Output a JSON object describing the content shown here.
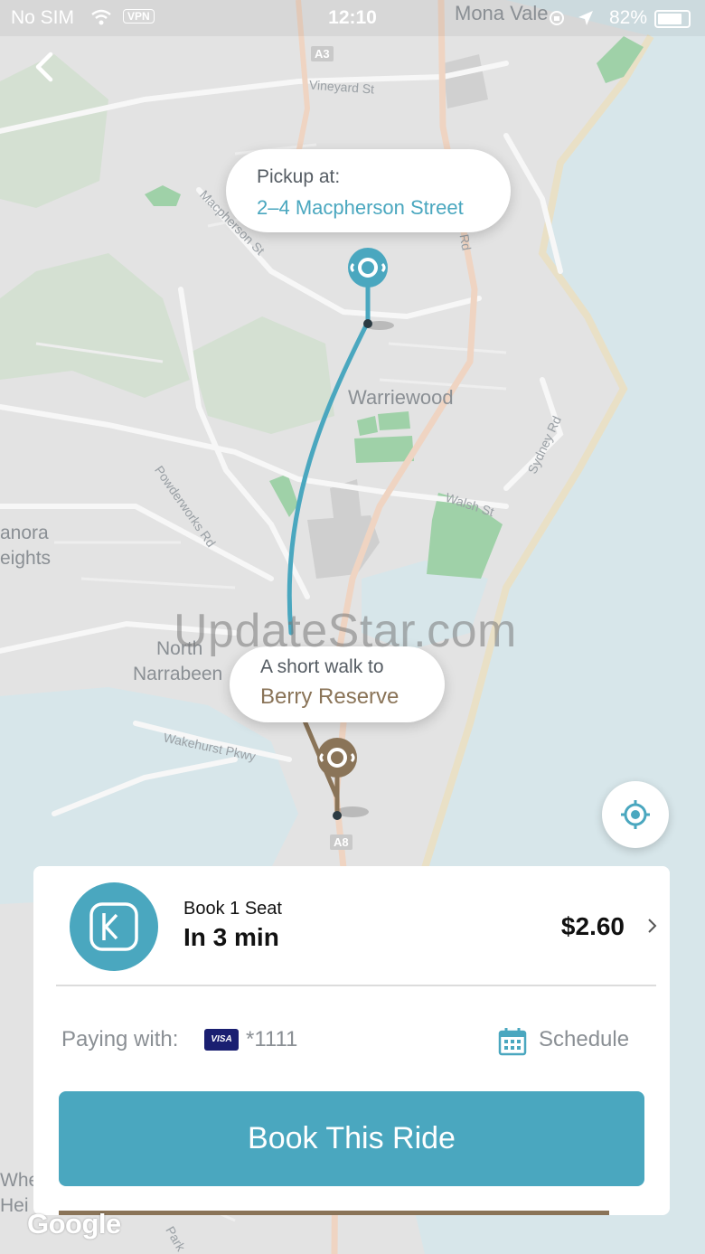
{
  "status_bar": {
    "carrier": "No SIM",
    "vpn": "VPN",
    "time": "12:10",
    "battery_pct": "82%"
  },
  "map": {
    "places": {
      "mona_vale": "Mona Vale",
      "warriewood": "Warriewood",
      "north": "North",
      "narrabeen": "Narrabeen",
      "anora": "anora",
      "eights": "eights",
      "whe": "Whe",
      "hei": "Hei"
    },
    "roads": {
      "vineyard": "Vineyard St",
      "macpherson": "Macpherson St",
      "rd": "Rd",
      "sydney_rd": "Sydney Rd",
      "walsh": "Walsh St",
      "powderworks": "Powderworks Rd",
      "wakehurst": "Wakehurst Pkwy",
      "park": "Park"
    },
    "shields": {
      "a3": "A3",
      "a8": "A8"
    },
    "watermark": "UpdateStar.com",
    "attribution": "Google"
  },
  "pickup": {
    "label": "Pickup at:",
    "address": "2–4 Macpherson Street"
  },
  "dropoff": {
    "label": "A short walk to",
    "place": "Berry Reserve"
  },
  "ride": {
    "seat_label": "Book 1 Seat",
    "eta": "In 3 min",
    "price": "$2.60",
    "paying_label": "Paying with:",
    "card_brand": "VISA",
    "card_number": "*1111",
    "schedule_label": "Schedule",
    "book_button": "Book This Ride",
    "progress": 0.94
  },
  "colors": {
    "accent": "#4aa7bf",
    "dropoff": "#8a7458",
    "card_brand_bg": "#1a1f71"
  },
  "icons": {
    "back": "chevron-left-icon",
    "locate": "crosshair-icon",
    "price": "chevron-right-icon",
    "schedule": "calendar-icon",
    "logo": "service-logo-icon"
  }
}
